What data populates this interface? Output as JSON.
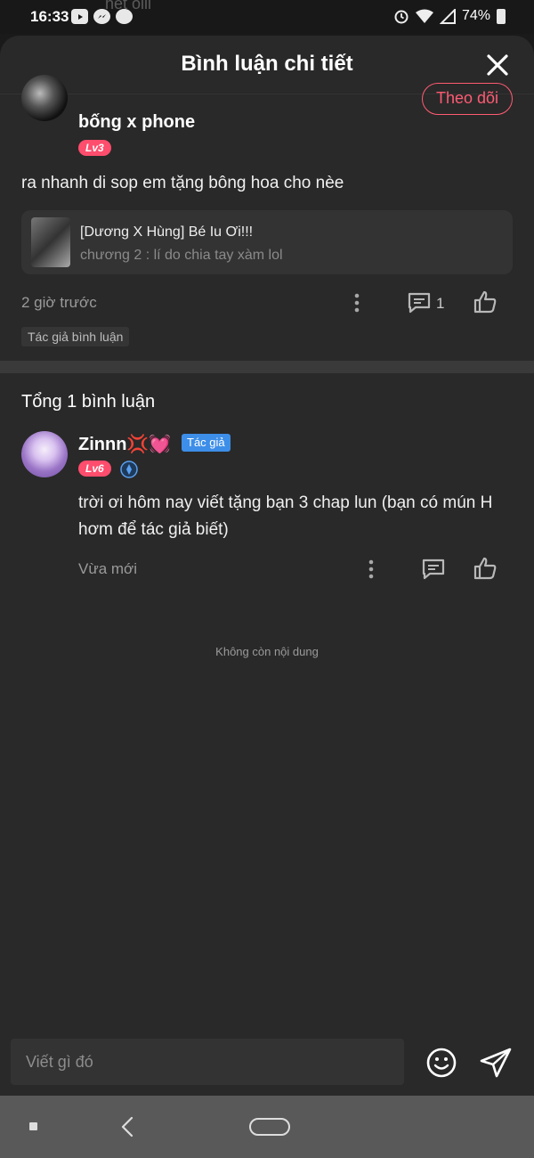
{
  "status_bar": {
    "time": "16:33",
    "ghost_text": "hết oiii",
    "battery": "74%"
  },
  "sheet": {
    "title": "Bình luận chi tiết"
  },
  "main_comment": {
    "username": "bống x phone",
    "level": "Lv3",
    "follow_label": "Theo dõi",
    "text": "ra nhanh di sop em tặng bông hoa cho nèe",
    "story": {
      "title": "[Dương X Hùng] Bé Iu Ơi!!!",
      "chapter": "chương 2 : lí do chia tay xàm lol"
    },
    "time": "2 giờ trước",
    "reply_count": "1",
    "tag": "Tác giả bình luận"
  },
  "replies": {
    "total_label": "Tổng 1 bình luận",
    "items": [
      {
        "username": "Zinnn💢💓",
        "author_badge": "Tác giả",
        "level": "Lv6",
        "text": "trời ơi hôm nay viết tặng bạn 3 chap lun (bạn có mún H hơm để tác giả biết)",
        "time": "Vừa mới"
      }
    ],
    "end_text": "Không còn nội dung"
  },
  "input": {
    "placeholder": "Viết gì đó"
  },
  "colors": {
    "accent": "#ff5b73",
    "level_badge": "#ff4d6d",
    "author_badge": "#3d8ee8",
    "sheet_bg": "#292929"
  },
  "icons": [
    "close-icon",
    "more-icon",
    "comment-icon",
    "like-icon",
    "emoji-icon",
    "send-icon",
    "verify-icon",
    "nav-recents-icon",
    "nav-back-icon",
    "nav-home-icon"
  ]
}
